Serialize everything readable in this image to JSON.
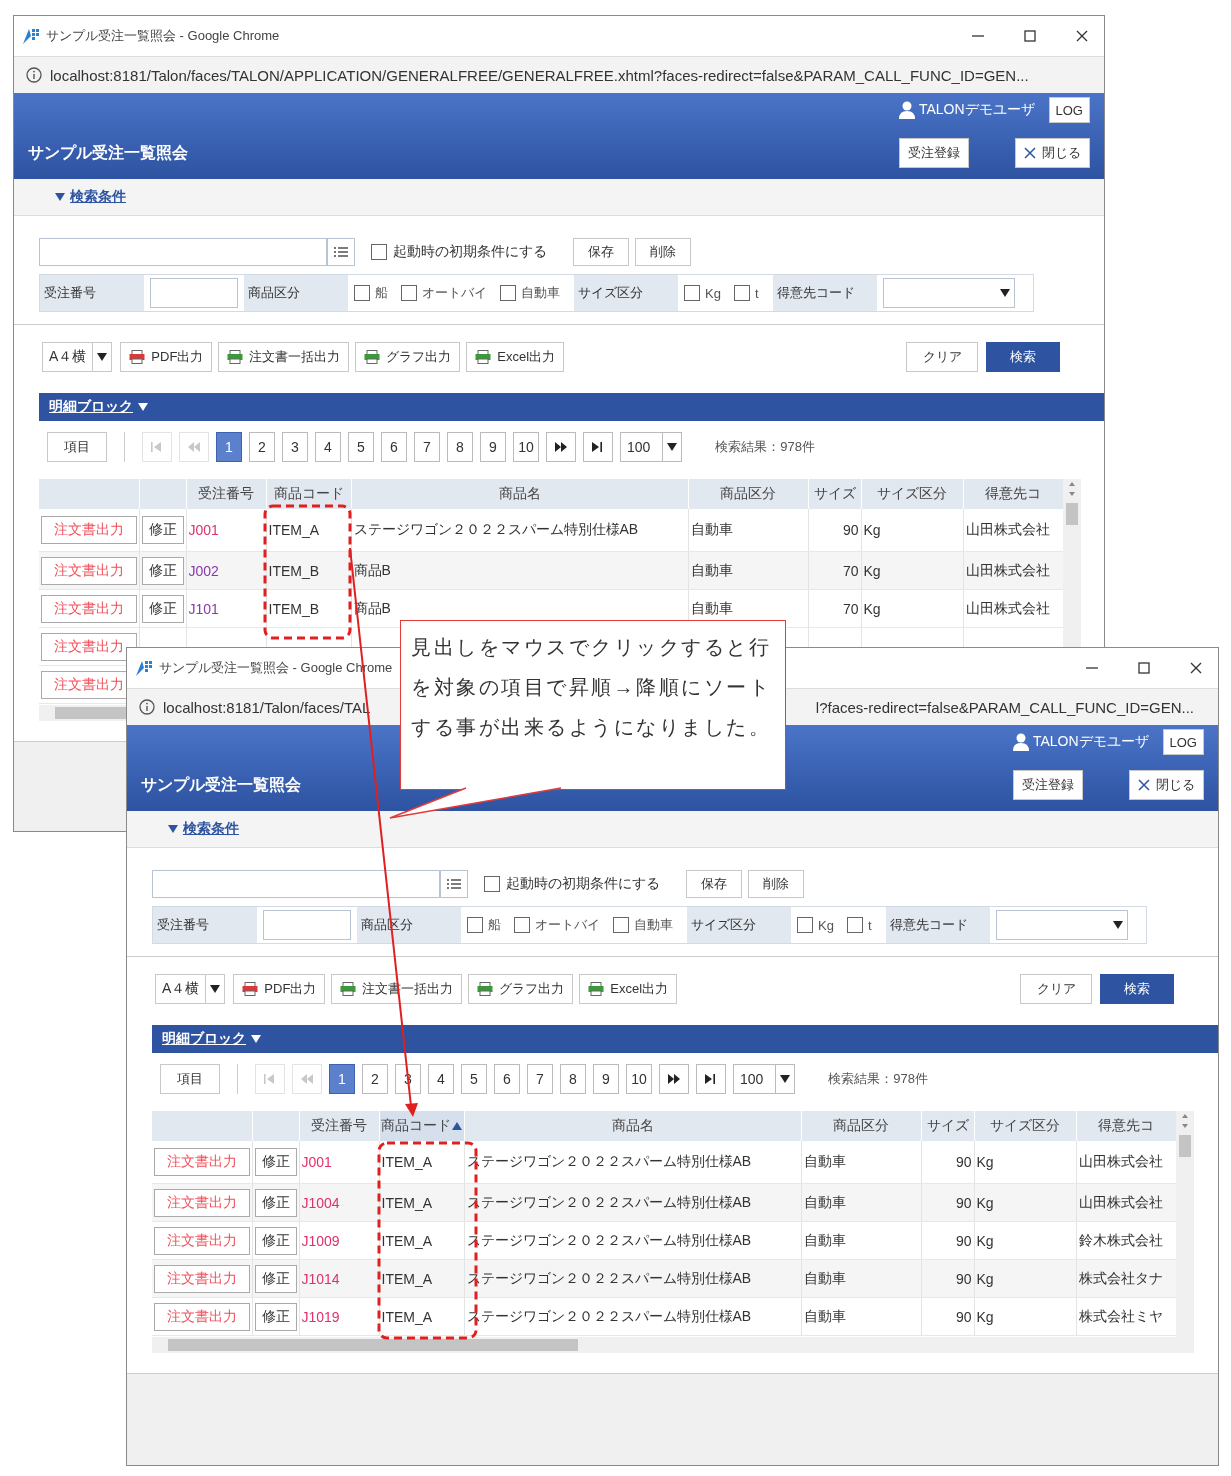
{
  "windows": [
    {
      "title": "サンプル受注一覧照会 - Google Chrome",
      "url_parts": [
        "localhost:8181/Talon/faces/TALON/APPLICATION/GENERALFREE/GENERALFREE.xhtml?faces-redirect=false&PARAM_CALL_FUNC_ID=GEN..."
      ],
      "user": "TALONデモユーザ",
      "logout_button": "LOG",
      "page_title": "サンプル受注一覧照会",
      "register_button": "受注登録",
      "close_button": "閉じる",
      "search_toggle": {
        "label": "検索条件",
        "expanded": true
      },
      "default_option": {
        "label": "起動時の初期条件にする",
        "checked": false
      },
      "condition_buttons": [
        "保存",
        "削除"
      ],
      "conditions": [
        {
          "kind": "input",
          "label": "受注番号"
        },
        {
          "kind": "checkboxes",
          "label": "商品区分",
          "options": [
            {
              "label": "船",
              "checked": false
            },
            {
              "label": "オートバイ",
              "checked": false
            },
            {
              "label": "自動車",
              "checked": false
            }
          ]
        },
        {
          "kind": "checkboxes",
          "label": "サイズ区分",
          "options": [
            {
              "label": "Kg",
              "checked": false
            },
            {
              "label": "t",
              "checked": false
            }
          ]
        },
        {
          "kind": "select",
          "label": "得意先コード"
        }
      ],
      "paper_size": "A４横",
      "output_buttons": [
        {
          "kind": "pdf",
          "label": "PDF出力"
        },
        {
          "kind": "sheet",
          "label": "注文書一括出力"
        },
        {
          "kind": "sheet",
          "label": "グラフ出力"
        },
        {
          "kind": "sheet",
          "label": "Excel出力"
        }
      ],
      "clear_button": "クリア",
      "search_button": "検索",
      "detail_block": {
        "label": "明細ブロック",
        "expanded": true
      },
      "pager": {
        "columns_button": "項目",
        "nav": [
          {
            "kind": "first",
            "disabled": true
          },
          {
            "kind": "prev",
            "disabled": true
          },
          {
            "kind": "next",
            "disabled": false
          },
          {
            "kind": "last",
            "disabled": false
          }
        ],
        "pages": [
          {
            "label": "1",
            "selected": true
          },
          {
            "label": "2",
            "selected": false
          },
          {
            "label": "3",
            "selected": false
          },
          {
            "label": "4",
            "selected": false
          },
          {
            "label": "5",
            "selected": false
          },
          {
            "label": "6",
            "selected": false
          },
          {
            "label": "7",
            "selected": false
          },
          {
            "label": "8",
            "selected": false
          },
          {
            "label": "9",
            "selected": false
          },
          {
            "label": "10",
            "selected": false
          }
        ],
        "page_size": "100",
        "result": "検索結果：978件"
      },
      "table": {
        "columns": [
          {
            "label": "受注番号",
            "sorted": false
          },
          {
            "label": "商品コード",
            "sorted": false
          },
          {
            "label": "商品名",
            "sorted": false
          },
          {
            "label": "商品区分",
            "sorted": false
          },
          {
            "label": "サイズ",
            "sorted": false
          },
          {
            "label": "サイズ区分",
            "sorted": false
          },
          {
            "label": "得意先コ",
            "sorted": false
          }
        ],
        "rows": [
          {
            "order_button": "注文書出力",
            "edit_button": "修正",
            "order_no": "J001",
            "visited": false,
            "code": "ITEM_A",
            "name": "ステージワゴン２０２２スパーム特別仕様AB",
            "category": "自動車",
            "size": "90",
            "size_unit": "Kg",
            "customer": "山田株式会社"
          },
          {
            "order_button": "注文書出力",
            "edit_button": "修正",
            "order_no": "J002",
            "visited": true,
            "code": "ITEM_B",
            "name": "商品B",
            "category": "自動車",
            "size": "70",
            "size_unit": "Kg",
            "customer": "山田株式会社"
          },
          {
            "order_button": "注文書出力",
            "edit_button": "修正",
            "order_no": "J101",
            "visited": true,
            "code": "ITEM_B",
            "name": "商品B",
            "category": "自動車",
            "size": "70",
            "size_unit": "Kg",
            "customer": "山田株式会社"
          },
          {
            "order_button": "注文書出力"
          },
          {
            "order_button": "注文書出力"
          }
        ]
      }
    },
    {
      "title": "サンプル受注一覧照会 - Google Chrome",
      "url_parts": [
        "localhost:8181/Talon/faces/TAL",
        "l?faces-redirect=false&PARAM_CALL_FUNC_ID=GEN..."
      ],
      "user": "TALONデモユーザ",
      "logout_button": "LOG",
      "page_title": "サンプル受注一覧照会",
      "register_button": "受注登録",
      "close_button": "閉じる",
      "search_toggle": {
        "label": "検索条件",
        "expanded": true
      },
      "default_option": {
        "label": "起動時の初期条件にする",
        "checked": false
      },
      "condition_buttons": [
        "保存",
        "削除"
      ],
      "conditions": [
        {
          "kind": "input",
          "label": "受注番号"
        },
        {
          "kind": "checkboxes",
          "label": "商品区分",
          "options": [
            {
              "label": "船",
              "checked": false
            },
            {
              "label": "オートバイ",
              "checked": false
            },
            {
              "label": "自動車",
              "checked": false
            }
          ]
        },
        {
          "kind": "checkboxes",
          "label": "サイズ区分",
          "options": [
            {
              "label": "Kg",
              "checked": false
            },
            {
              "label": "t",
              "checked": false
            }
          ]
        },
        {
          "kind": "select",
          "label": "得意先コード"
        }
      ],
      "paper_size": "A４横",
      "output_buttons": [
        {
          "kind": "pdf",
          "label": "PDF出力"
        },
        {
          "kind": "sheet",
          "label": "注文書一括出力"
        },
        {
          "kind": "sheet",
          "label": "グラフ出力"
        },
        {
          "kind": "sheet",
          "label": "Excel出力"
        }
      ],
      "clear_button": "クリア",
      "search_button": "検索",
      "detail_block": {
        "label": "明細ブロック",
        "expanded": true
      },
      "pager": {
        "columns_button": "項目",
        "nav": [
          {
            "kind": "first",
            "disabled": true
          },
          {
            "kind": "prev",
            "disabled": true
          },
          {
            "kind": "next",
            "disabled": false
          },
          {
            "kind": "last",
            "disabled": false
          }
        ],
        "pages": [
          {
            "label": "1",
            "selected": true
          },
          {
            "label": "2",
            "selected": false
          },
          {
            "label": "3",
            "selected": false
          },
          {
            "label": "4",
            "selected": false
          },
          {
            "label": "5",
            "selected": false
          },
          {
            "label": "6",
            "selected": false
          },
          {
            "label": "7",
            "selected": false
          },
          {
            "label": "8",
            "selected": false
          },
          {
            "label": "9",
            "selected": false
          },
          {
            "label": "10",
            "selected": false
          }
        ],
        "page_size": "100",
        "result": "検索結果：978件"
      },
      "table": {
        "columns": [
          {
            "label": "受注番号",
            "sorted": false
          },
          {
            "label": "商品コード",
            "sorted": true
          },
          {
            "label": "商品名",
            "sorted": false
          },
          {
            "label": "商品区分",
            "sorted": false
          },
          {
            "label": "サイズ",
            "sorted": false
          },
          {
            "label": "サイズ区分",
            "sorted": false
          },
          {
            "label": "得意先コ",
            "sorted": false
          }
        ],
        "rows": [
          {
            "order_button": "注文書出力",
            "edit_button": "修正",
            "order_no": "J001",
            "visited": false,
            "code": "ITEM_A",
            "name": "ステージワゴン２０２２スパーム特別仕様AB",
            "category": "自動車",
            "size": "90",
            "size_unit": "Kg",
            "customer": "山田株式会社"
          },
          {
            "order_button": "注文書出力",
            "edit_button": "修正",
            "order_no": "J1004",
            "visited": false,
            "code": "ITEM_A",
            "name": "ステージワゴン２０２２スパーム特別仕様AB",
            "category": "自動車",
            "size": "90",
            "size_unit": "Kg",
            "customer": "山田株式会社"
          },
          {
            "order_button": "注文書出力",
            "edit_button": "修正",
            "order_no": "J1009",
            "visited": false,
            "code": "ITEM_A",
            "name": "ステージワゴン２０２２スパーム特別仕様AB",
            "category": "自動車",
            "size": "90",
            "size_unit": "Kg",
            "customer": "鈴木株式会社"
          },
          {
            "order_button": "注文書出力",
            "edit_button": "修正",
            "order_no": "J1014",
            "visited": false,
            "code": "ITEM_A",
            "name": "ステージワゴン２０２２スパーム特別仕様AB",
            "category": "自動車",
            "size": "90",
            "size_unit": "Kg",
            "customer": "株式会社タナ"
          },
          {
            "order_button": "注文書出力",
            "edit_button": "修正",
            "order_no": "J1019",
            "visited": false,
            "code": "ITEM_A",
            "name": "ステージワゴン２０２２スパーム特別仕様AB",
            "category": "自動車",
            "size": "90",
            "size_unit": "Kg",
            "customer": "株式会社ミヤ"
          }
        ]
      }
    }
  ],
  "callout": {
    "text": "見出しをマウスでクリックすると行を対象の項目で昇順→降順にソートする事が出来るようになりました。"
  }
}
